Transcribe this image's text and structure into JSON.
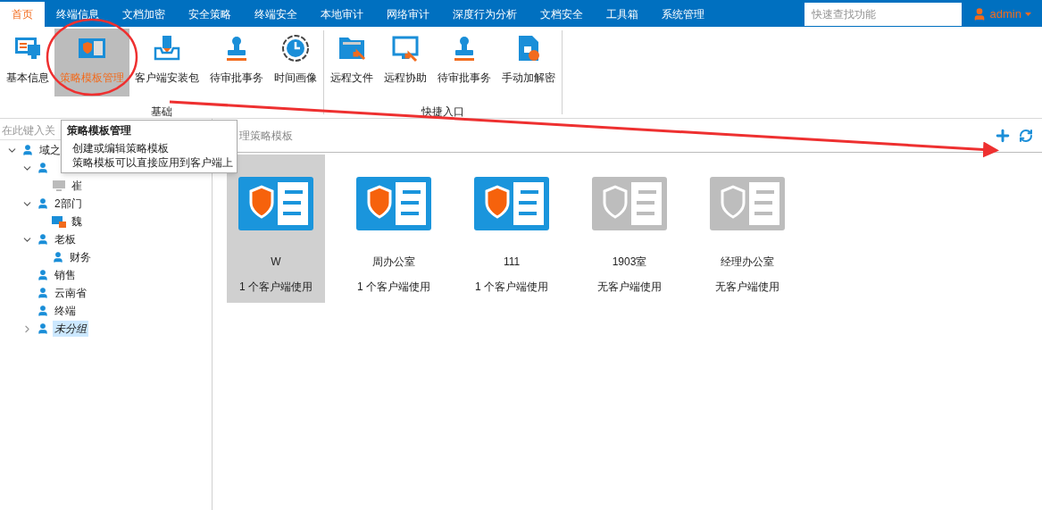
{
  "menu_tabs": [
    {
      "label": "首页",
      "selected": true
    },
    {
      "label": "终端信息",
      "selected": false
    },
    {
      "label": "文档加密",
      "selected": false
    },
    {
      "label": "安全策略",
      "selected": false
    },
    {
      "label": "终端安全",
      "selected": false
    },
    {
      "label": "本地审计",
      "selected": false
    },
    {
      "label": "网络审计",
      "selected": false
    },
    {
      "label": "深度行为分析",
      "selected": false
    },
    {
      "label": "文档安全",
      "selected": false
    },
    {
      "label": "工具箱",
      "selected": false
    },
    {
      "label": "系统管理",
      "selected": false
    }
  ],
  "quick_search": {
    "placeholder": "快速查找功能"
  },
  "user": {
    "name": "admin"
  },
  "ribbon_groups": [
    {
      "label": "基础",
      "items": [
        {
          "label": "基本信息",
          "kind": "monitor",
          "selected": false
        },
        {
          "label": "策略模板管理",
          "kind": "template",
          "selected": true
        },
        {
          "label": "客户端安装包",
          "kind": "package",
          "selected": false
        },
        {
          "label": "待审批事务",
          "kind": "stamp",
          "selected": false
        },
        {
          "label": "时间画像",
          "kind": "clock",
          "selected": false
        }
      ]
    },
    {
      "label": "快捷入口",
      "items": [
        {
          "label": "远程文件",
          "kind": "folder",
          "selected": false
        },
        {
          "label": "远程协助",
          "kind": "remote",
          "selected": false
        },
        {
          "label": "待审批事务",
          "kind": "stamp",
          "selected": false
        },
        {
          "label": "手动加解密",
          "kind": "unlock",
          "selected": false
        }
      ]
    }
  ],
  "tooltip": {
    "title": "策略模板管理",
    "lines": [
      "创建或编辑策略模板",
      "策略模板可以直接应用到客户端上"
    ]
  },
  "sidebar": {
    "search": {
      "placeholder": "在此键入关"
    },
    "tree": [
      {
        "label": "域之",
        "kind": "group",
        "expanded": true,
        "selected": false,
        "children": [
          {
            "kind": "group",
            "expanded": true,
            "children": [
              {
                "label": "崔",
                "kind": "computer",
                "selected": false
              }
            ]
          },
          {
            "label": "2部门",
            "kind": "group",
            "expanded": true,
            "selected": false,
            "children": [
              {
                "label": "魏",
                "kind": "locked",
                "selected": false
              }
            ]
          },
          {
            "label": "老板",
            "kind": "group",
            "expanded": true,
            "selected": false,
            "children": [
              {
                "label": "财务",
                "kind": "group",
                "selected": false
              }
            ]
          },
          {
            "label": "销售",
            "kind": "group",
            "selected": false
          },
          {
            "label": "云南省",
            "kind": "group",
            "selected": false
          },
          {
            "label": "终端",
            "kind": "group",
            "selected": false
          },
          {
            "label": "未分组",
            "kind": "group",
            "expanded": false,
            "selected": true
          }
        ]
      }
    ]
  },
  "content": {
    "title": "理策略模板",
    "templates": [
      {
        "name": "W",
        "usage": "1 个客户端使用",
        "in_use": true,
        "selected": true
      },
      {
        "name": "周办公室",
        "usage": "1 个客户端使用",
        "in_use": true,
        "selected": false
      },
      {
        "name": "111",
        "usage": "1 个客户端使用",
        "in_use": true,
        "selected": false
      },
      {
        "name": "1903室",
        "usage": "无客户端使用",
        "in_use": false,
        "selected": false
      },
      {
        "name": "经理办公室",
        "usage": "无客户端使用",
        "in_use": false,
        "selected": false
      }
    ]
  }
}
